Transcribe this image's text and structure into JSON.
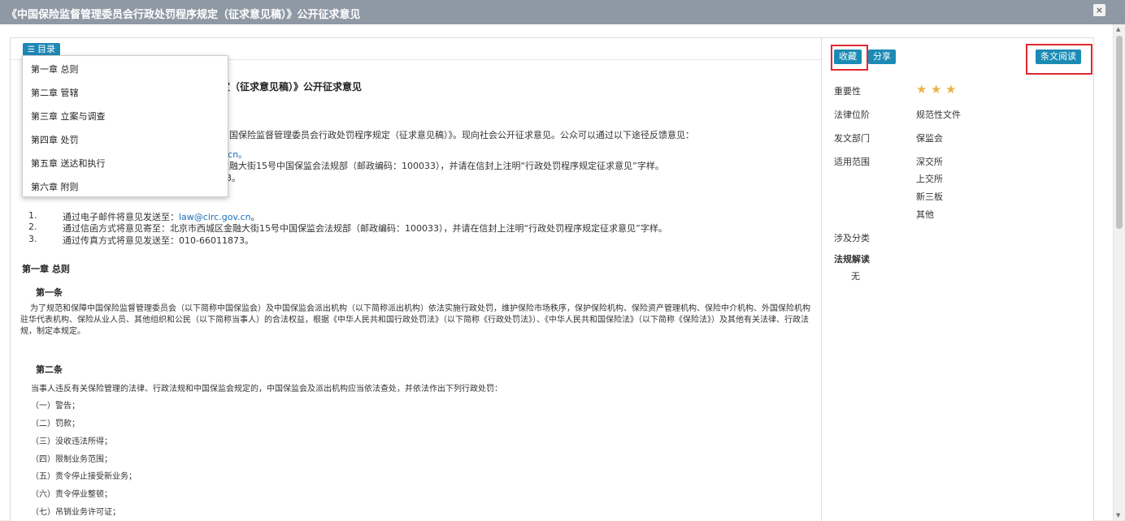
{
  "window": {
    "title": "《中国保险监督管理委员会行政处罚程序规定（征求意见稿）》公开征求意见",
    "close_glyph": "×"
  },
  "toc": {
    "button_label": "目录",
    "items": [
      "第一章 总则",
      "第二章 管辖",
      "第三章 立案与调查",
      "第四章 处罚",
      "第五章 送达和执行",
      "第六章 附则"
    ]
  },
  "doc": {
    "title_visible": "规定（征求意见稿）》公开征求意见",
    "intro_visible": "中国保险监督管理委员会行政处罚程序规定（征求意见稿）》。现向社会公开征求意见。公众可以通过以下途径反馈意见：",
    "partial_email": "v.cn。",
    "partial_mail": "金融大街15号中国保监会法规部（邮政编码：100033），并请在信封上注明“行政处罚程序规定征求意见”字样。",
    "partial_fax": "73。",
    "list": [
      {
        "num": "1.",
        "text": "通过电子邮件将意见发送至：",
        "link": "law@circ.gov.cn",
        "suffix": "。"
      },
      {
        "num": "2.",
        "text": "通过信函方式将意见寄至：北京市西城区金融大街15号中国保监会法规部（邮政编码：100033），并请在信封上注明“行政处罚程序规定征求意见”字样。",
        "link": "",
        "suffix": ""
      },
      {
        "num": "3.",
        "text": "通过传真方式将意见发送至：010-66011873。",
        "link": "",
        "suffix": ""
      }
    ],
    "chapter1": "第一章 总则",
    "article1": "第一条",
    "article1_text": "为了规范和保障中国保险监督管理委员会（以下简称中国保监会）及中国保监会派出机构（以下简称派出机构）依法实施行政处罚，维护保险市场秩序，保护保险机构、保险资产管理机构、保险中介机构、外国保险机构驻华代表机构、保险从业人员、其他组织和公民（以下简称当事人）的合法权益，根据《中华人民共和国行政处罚法》（以下简称《行政处罚法》）、《中华人民共和国保险法》（以下简称《保险法》）及其他有关法律、行政法规，制定本规定。",
    "article2": "第二条",
    "article2_text": "当事人违反有关保险管理的法律、行政法规和中国保监会规定的，中国保监会及派出机构应当依法查处，并依法作出下列行政处罚：",
    "penalties": [
      "（一）警告；",
      "（二）罚款；",
      "（三）没收违法所得；",
      "（四）限制业务范围；",
      "（五）责令停止接受新业务；",
      "（六）责令停业整顿；",
      "（七）吊销业务许可证；"
    ]
  },
  "sidebar": {
    "favorite_label": "收藏",
    "share_label": "分享",
    "clause_read_label": "条文阅读",
    "importance_label": "重要性",
    "importance_stars": 3,
    "legal_rank_label": "法律位阶",
    "legal_rank_value": "规范性文件",
    "issuer_label": "发文部门",
    "issuer_value": "保监会",
    "scope_label": "适用范围",
    "scope_values": [
      "深交所",
      "上交所",
      "新三板",
      "其他"
    ],
    "category_label": "涉及分类",
    "interpretation_label": "法规解读",
    "interpretation_value": "无"
  },
  "colors": {
    "button_blue": "#1b8bb4",
    "highlight_red": "#e0282e",
    "star": "#e8b448",
    "titlebar": "#8e99a5"
  }
}
